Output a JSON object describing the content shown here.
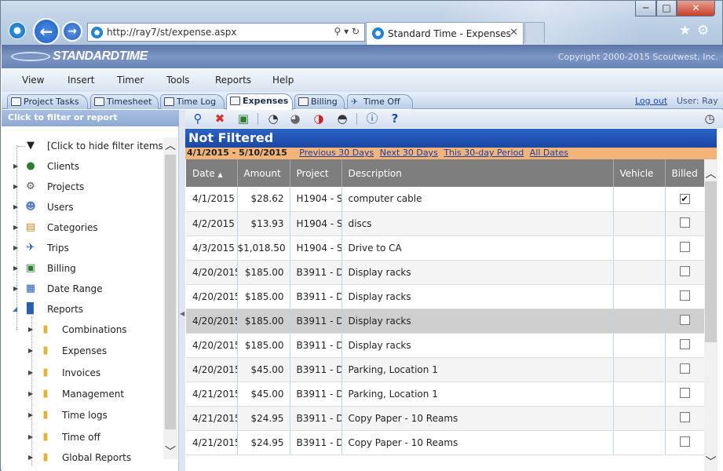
{
  "browser": {
    "url": "http://ray7/st/expense.aspx",
    "tab_title": "Standard Time - Expenses",
    "window_controls": {
      "minimize": "─",
      "maximize": "□",
      "close": "✕"
    }
  },
  "app": {
    "logo_text": "STANDARDTIME",
    "copyright": "Copyright 2000-2015 Scoutwest, Inc."
  },
  "menu": [
    "View",
    "Insert",
    "Timer",
    "Tools",
    "Reports",
    "Help"
  ],
  "tabs": {
    "items": [
      "Project Tasks",
      "Timesheet",
      "Time Log",
      "Expenses",
      "Billing",
      "Time Off"
    ],
    "active": "Expenses",
    "logout": "Log out",
    "user": "User: Ray"
  },
  "sidebar": {
    "header": "Click to filter or report",
    "items": [
      {
        "label": "[Click to hide filter items]",
        "icon": "funnel-icon"
      },
      {
        "label": "Clients",
        "icon": "clients-icon"
      },
      {
        "label": "Projects",
        "icon": "projects-gear-icon"
      },
      {
        "label": "Users",
        "icon": "users-icon"
      },
      {
        "label": "Categories",
        "icon": "categories-icon"
      },
      {
        "label": "Trips",
        "icon": "airplane-icon"
      },
      {
        "label": "Billing",
        "icon": "money-icon"
      },
      {
        "label": "Date Range",
        "icon": "calendar-icon"
      },
      {
        "label": "Reports",
        "icon": "book-icon"
      }
    ],
    "reports_children": [
      "Combinations",
      "Expenses",
      "Invoices",
      "Management",
      "Time logs",
      "Time off",
      "Global Reports"
    ]
  },
  "filter": {
    "title": "Not Filtered",
    "range": "4/1/2015 - 5/10/2015",
    "links": [
      "Previous 30 Days",
      "Next 30 Days",
      "This 30-day Period",
      "All Dates"
    ]
  },
  "grid": {
    "columns": [
      "Date",
      "Amount",
      "Project",
      "Description",
      "Vehicle",
      "Billed"
    ],
    "sort_indicator": "▲",
    "rows": [
      {
        "date": "4/1/2015",
        "amount": "$28.62",
        "project": "H1904 - S",
        "description": "computer cable",
        "vehicle": "",
        "billed": true
      },
      {
        "date": "4/2/2015",
        "amount": "$13.93",
        "project": "H1904 - S",
        "description": "discs",
        "vehicle": "",
        "billed": false
      },
      {
        "date": "4/3/2015",
        "amount": "$1,018.50",
        "project": "H1904 - S",
        "description": "Drive to CA",
        "vehicle": "",
        "billed": false
      },
      {
        "date": "4/20/2015",
        "amount": "$185.00",
        "project": "B3911 - D",
        "description": "Display racks",
        "vehicle": "",
        "billed": false
      },
      {
        "date": "4/20/2015",
        "amount": "$185.00",
        "project": "B3911 - D",
        "description": "Display racks",
        "vehicle": "",
        "billed": false
      },
      {
        "date": "4/20/2015",
        "amount": "$185.00",
        "project": "B3911 - D",
        "description": "Display racks",
        "vehicle": "",
        "billed": false
      },
      {
        "date": "4/20/2015",
        "amount": "$185.00",
        "project": "B3911 - D",
        "description": "Display racks",
        "vehicle": "",
        "billed": false
      },
      {
        "date": "4/20/2015",
        "amount": "$45.00",
        "project": "B3911 - D",
        "description": "Parking, Location 1",
        "vehicle": "",
        "billed": false
      },
      {
        "date": "4/21/2015",
        "amount": "$45.00",
        "project": "B3911 - D",
        "description": "Parking, Location 1",
        "vehicle": "",
        "billed": false
      },
      {
        "date": "4/21/2015",
        "amount": "$24.95",
        "project": "B3911 - D",
        "description": "Copy Paper - 10 Reams",
        "vehicle": "",
        "billed": false
      },
      {
        "date": "4/21/2015",
        "amount": "$24.95",
        "project": "B3911 - D",
        "description": "Copy Paper - 10 Reams",
        "vehicle": "",
        "billed": false
      }
    ],
    "selected_row_index": 5
  },
  "colors": {
    "filter_bar": "#1f4fae",
    "date_row": "#f3b47a",
    "grid_header": "#7e7e7e",
    "banner": "#6e88ba"
  }
}
